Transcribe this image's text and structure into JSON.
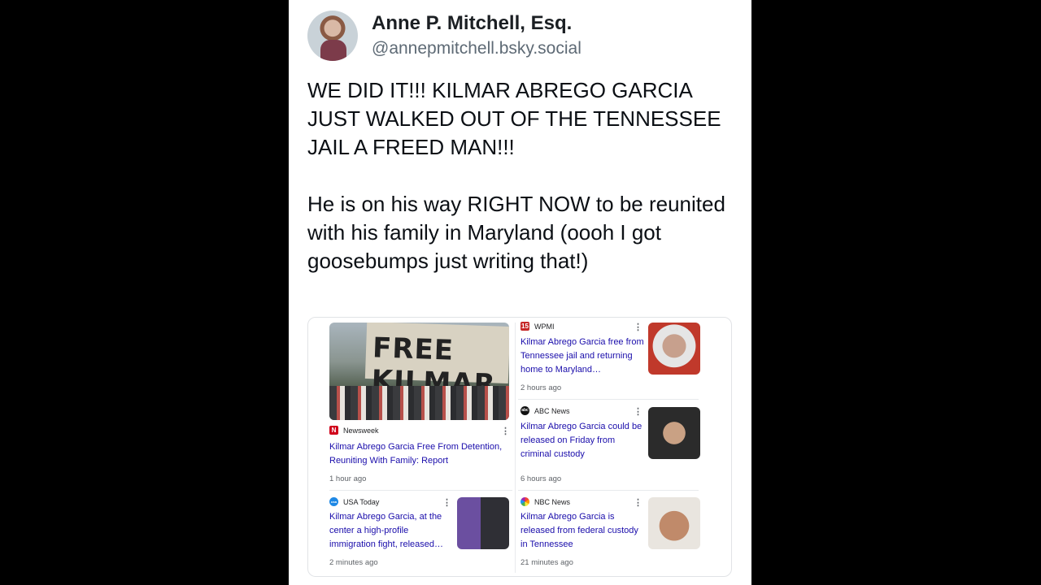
{
  "author": {
    "name": "Anne P. Mitchell, Esq.",
    "handle": "@annepmitchell.bsky.social"
  },
  "post": {
    "text": "WE DID IT!!! KILMAR ABREGO GARCIA JUST WALKED OUT OF THE TENNESSEE JAIL A FREED MAN!!!\n\nHe is on his way RIGHT NOW to be reunited with his family in Maryland (oooh I got goosebumps just writing that!)"
  },
  "news": {
    "hero_sign_text": "FREE KILMAR",
    "items": [
      {
        "source": "Newsweek",
        "source_icon": "N",
        "headline": "Kilmar Abrego Garcia Free From Detention, Reuniting With Family: Report",
        "time": "1 hour ago"
      },
      {
        "source": "WPMI",
        "source_icon": "15",
        "headline": "Kilmar Abrego Garcia free from Tennessee jail and returning home to Maryland…",
        "time": "2 hours ago"
      },
      {
        "source": "ABC News",
        "source_icon": "abc",
        "headline": "Kilmar Abrego Garcia could be released on Friday from criminal custody",
        "time": "6 hours ago"
      },
      {
        "source": "USA Today",
        "source_icon": "usa",
        "headline": "Kilmar Abrego Garcia, at the center a high-profile immigration fight, released…",
        "time": "2 minutes ago"
      },
      {
        "source": "NBC News",
        "source_icon": "nbc",
        "headline": "Kilmar Abrego Garcia is released from federal custody in Tennessee",
        "time": "21 minutes ago"
      }
    ]
  },
  "colors": {
    "headline": "#1a0dab",
    "newsweek": "#d0021b",
    "wpmi": "#c62828",
    "abc": "#111111",
    "usa": "#1e88e5"
  }
}
